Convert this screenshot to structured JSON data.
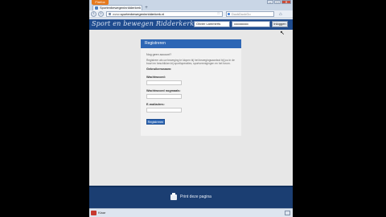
{
  "browser": {
    "app_button_label": "Firefox",
    "tab_title": "Sportenbewegeninridderkerk",
    "new_tab_icon": "plus-icon",
    "url": {
      "prefix": "www.",
      "host": "sportenbewegeninridderkerk.nl"
    },
    "search_placeholder": "DuckDuckGo",
    "window_controls": {
      "minimize": "–",
      "maximize": "□",
      "close": "✕"
    }
  },
  "site": {
    "title": "Sport en bewegen Ridderkerk",
    "login": {
      "username_value": "Olivier Lammerts",
      "password_value": "••••••••••••••••",
      "button_label": "Inloggen"
    }
  },
  "register": {
    "heading": "Registreren",
    "intro": "Nog geen account?",
    "description": "Registreer als uw beweging te klopen bij het bewegingsaanbod bij jou in de buurt en beschikken bij sportloperaties, sportverenigingen en het forum.",
    "section_label": "Gebruikersnaam:",
    "fields": [
      {
        "label": "Wachtwoord:"
      },
      {
        "label": "Wachtwoord nogmaals:"
      },
      {
        "label": "E-mailadres:"
      }
    ],
    "submit_label": "Registreren"
  },
  "footer": {
    "print_label": "Print deze pagina"
  },
  "statusbar": {
    "text": "Klaar"
  },
  "colors": {
    "header": "#1f4c8f",
    "panel_header": "#2e67b5",
    "footer": "#1b3e72",
    "app_button": "#e5791d"
  }
}
